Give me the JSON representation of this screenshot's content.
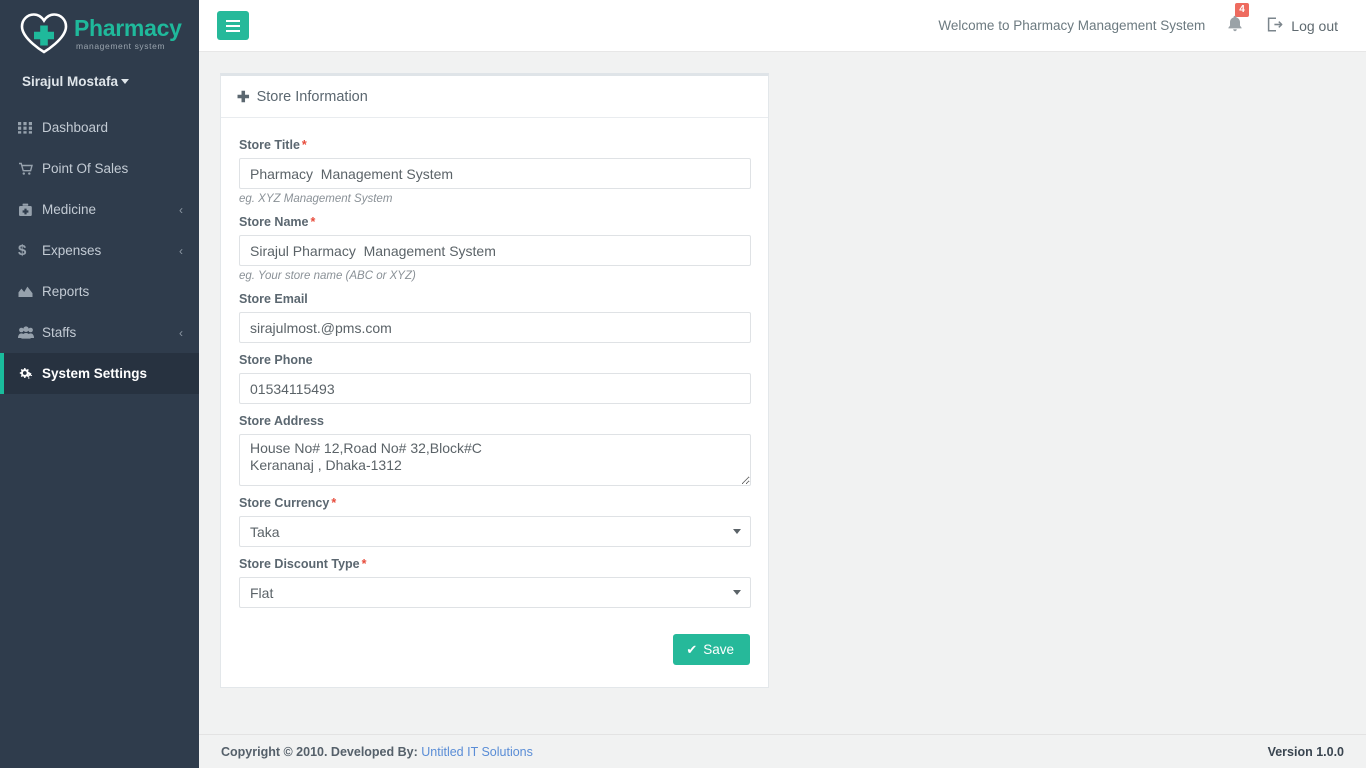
{
  "brand": {
    "title": "Pharmacy",
    "subtitle": "management system",
    "logo_icon": "heart-cross-icon",
    "accent_color": "#1fb99b"
  },
  "sidebar": {
    "user_name": "Sirajul Mostafa",
    "items": [
      {
        "label": "Dashboard",
        "icon": "grid-icon",
        "arrow": "",
        "active": false
      },
      {
        "label": "Point Of Sales",
        "icon": "cart-icon",
        "arrow": "",
        "active": false
      },
      {
        "label": "Medicine",
        "icon": "medkit-icon",
        "arrow": "‹",
        "active": false
      },
      {
        "label": "Expenses",
        "icon": "dollar-icon",
        "arrow": "‹",
        "active": false
      },
      {
        "label": "Reports",
        "icon": "area-chart-icon",
        "arrow": "",
        "active": false
      },
      {
        "label": "Staffs",
        "icon": "users-icon",
        "arrow": "‹",
        "active": false
      },
      {
        "label": "System Settings",
        "icon": "cogs-icon",
        "arrow": "",
        "active": true
      }
    ]
  },
  "topbar": {
    "menu_toggle_icon": "hamburger-icon",
    "welcome_text": "Welcome to Pharmacy Management System",
    "bell_icon": "bell-icon",
    "notification_count": "4",
    "logout_icon": "sign-out-icon",
    "logout_label": "Log out"
  },
  "panel": {
    "heading_icon": "plus-icon",
    "heading": "Store Information"
  },
  "form": {
    "fields": [
      {
        "name": "store-title",
        "label": "Store Title",
        "required": true,
        "type": "text",
        "value": "Pharmacy  Management System",
        "placeholder": "Store Title",
        "help": "eg. XYZ Management System"
      },
      {
        "name": "store-name",
        "label": "Store Name",
        "required": true,
        "type": "text",
        "value": "Sirajul Pharmacy  Management System",
        "placeholder": "Store Name",
        "help": "eg. Your store name (ABC or XYZ)"
      },
      {
        "name": "store-email",
        "label": "Store Email",
        "required": false,
        "type": "text",
        "value": "sirajulmost.@pms.com",
        "placeholder": "Store Email",
        "help": ""
      },
      {
        "name": "store-phone",
        "label": "Store Phone",
        "required": false,
        "type": "text",
        "value": "01534115493",
        "placeholder": "Store Phone",
        "help": ""
      },
      {
        "name": "store-address",
        "label": "Store Address",
        "required": false,
        "type": "textarea",
        "value": "House No# 12,Road No# 32,Block#C\nKerananaj , Dhaka-1312",
        "placeholder": "Store Address",
        "help": ""
      },
      {
        "name": "store-currency",
        "label": "Store Currency",
        "required": true,
        "type": "select",
        "value": "Taka",
        "options": [
          "Taka"
        ],
        "help": ""
      },
      {
        "name": "store-discount-type",
        "label": "Store Discount Type",
        "required": true,
        "type": "select",
        "value": "Flat",
        "options": [
          "Flat"
        ],
        "help": ""
      }
    ],
    "save_icon": "check-icon",
    "save_label": "Save",
    "required_marker": "*"
  },
  "footer": {
    "copyright": "Copyright © 2010. Developed By:",
    "developer_link": "Untitled IT Solutions",
    "version": "Version 1.0.0"
  }
}
